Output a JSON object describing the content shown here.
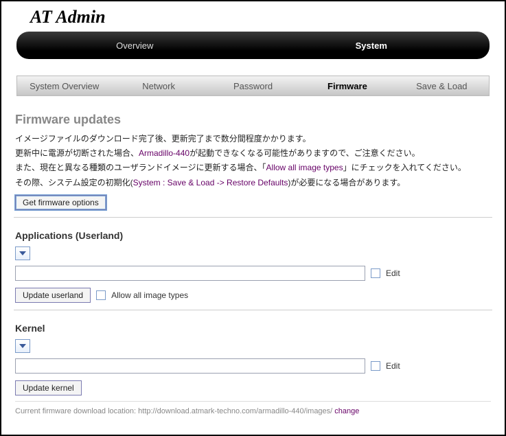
{
  "brand": "AT Admin",
  "topTabs": {
    "overview": "Overview",
    "system": "System"
  },
  "subTabs": {
    "system_overview": "System Overview",
    "network": "Network",
    "password": "Password",
    "firmware": "Firmware",
    "save_load": "Save & Load"
  },
  "firmware": {
    "title": "Firmware updates",
    "p1": "イメージファイルのダウンロード完了後、更新完了まで数分間程度かかります。",
    "p2a": "更新中に電源が切断された場合、",
    "p2_hl": "Armadillo-440",
    "p2b": "が起動できなくなる可能性がありますので、ご注意ください。",
    "p3a": "また、現在と異なる種類のユーザランドイメージに更新する場合、「",
    "p3_hl": "Allow all image types",
    "p3b": "」にチェックを入れてください。",
    "p4a": "その際、システム設定の初期化(",
    "p4_hl": "System : Save & Load -> Restore Defaults",
    "p4b": ")が必要になる場合があります。",
    "get_options_btn": "Get firmware options"
  },
  "userland": {
    "heading": "Applications (Userland)",
    "value": "",
    "edit_label": "Edit",
    "update_btn": "Update userland",
    "allow_label": "Allow all image types"
  },
  "kernel": {
    "heading": "Kernel",
    "value": "",
    "edit_label": "Edit",
    "update_btn": "Update kernel"
  },
  "footer": {
    "prefix": "Current firmware download location: ",
    "url": "http://download.atmark-techno.com/armadillo-440/images/",
    "change": "change"
  }
}
